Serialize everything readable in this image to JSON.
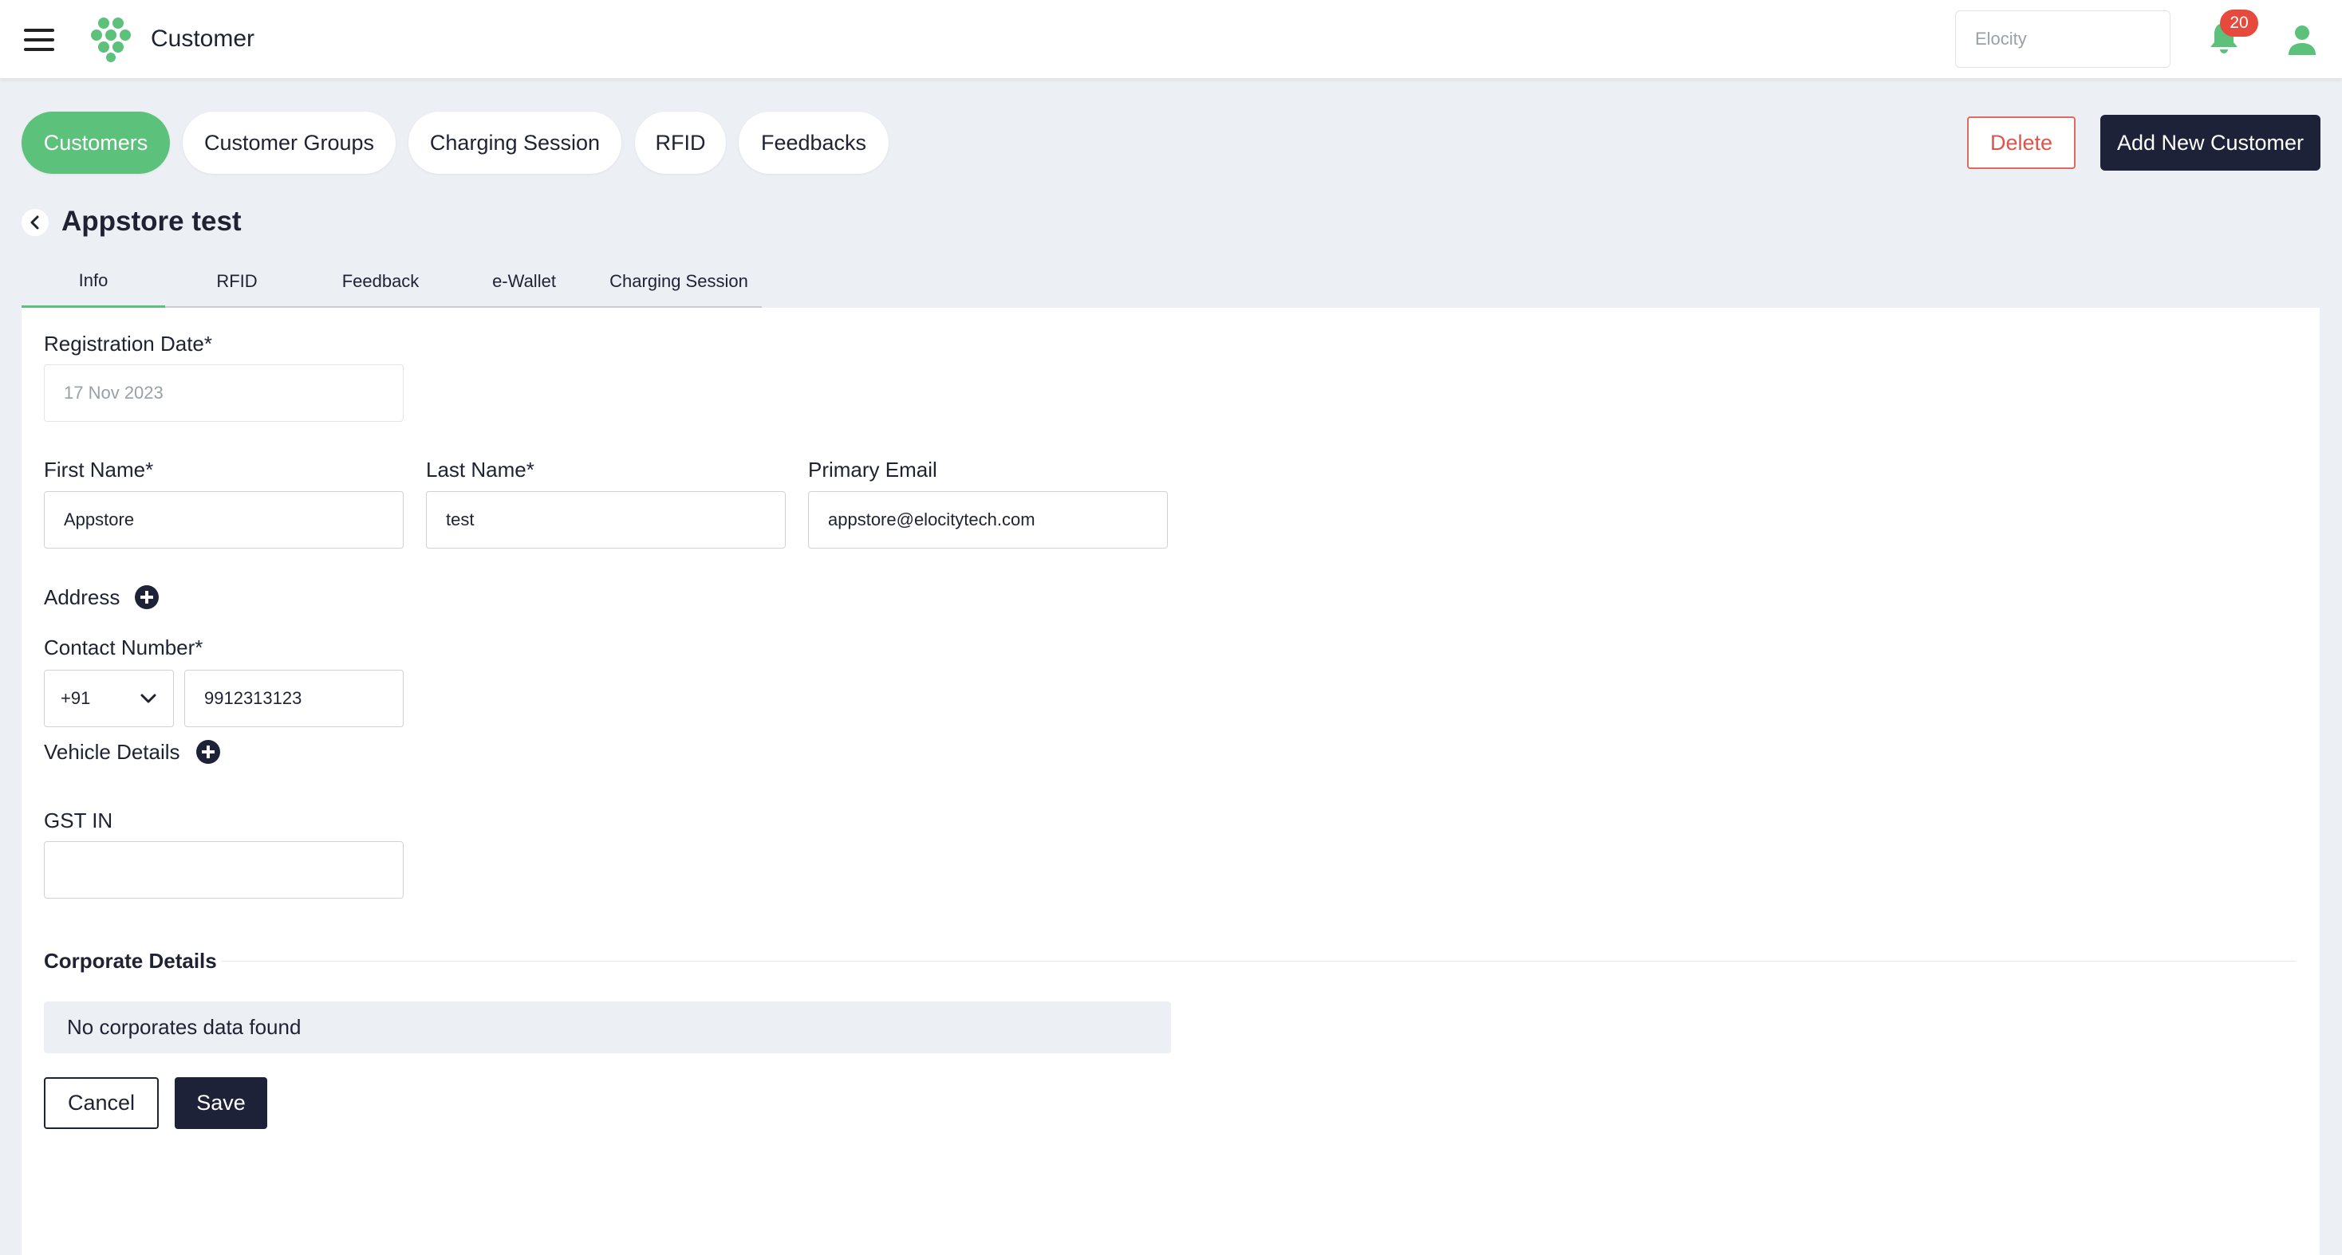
{
  "header": {
    "title": "Customer",
    "org_select_placeholder": "Elocity",
    "notification_count": "20",
    "brand_color": "#5cc17a"
  },
  "nav_pills": [
    {
      "label": "Customers",
      "active": true
    },
    {
      "label": "Customer Groups",
      "active": false
    },
    {
      "label": "Charging Session",
      "active": false
    },
    {
      "label": "RFID",
      "active": false
    },
    {
      "label": "Feedbacks",
      "active": false
    }
  ],
  "actions": {
    "delete_label": "Delete",
    "add_label": "Add New Customer"
  },
  "page": {
    "title": "Appstore test"
  },
  "tabs": [
    {
      "label": "Info",
      "active": true
    },
    {
      "label": "RFID",
      "active": false
    },
    {
      "label": "Feedback",
      "active": false
    },
    {
      "label": "e-Wallet",
      "active": false
    },
    {
      "label": "Charging Session",
      "active": false
    }
  ],
  "form": {
    "registration_date_label": "Registration Date*",
    "registration_date_value": "17 Nov 2023",
    "first_name_label": "First Name*",
    "first_name_value": "Appstore",
    "last_name_label": "Last Name*",
    "last_name_value": "test",
    "primary_email_label": "Primary Email",
    "primary_email_value": "appstore@elocitytech.com",
    "address_label": "Address",
    "contact_number_label": "Contact Number*",
    "country_code": "+91",
    "contact_number_value": "9912313123",
    "vehicle_details_label": "Vehicle Details",
    "gst_label": "GST IN",
    "gst_value": ""
  },
  "corporate": {
    "section_title": "Corporate Details",
    "empty_message": "No corporates data found"
  },
  "footer_buttons": {
    "cancel_label": "Cancel",
    "save_label": "Save"
  },
  "icons": {
    "menu": "hamburger-menu-icon",
    "logo": "hexagon-cluster-logo",
    "notifications": "bell-icon",
    "user": "user-icon",
    "back": "chevron-left-icon",
    "dropdown": "chevron-down-icon",
    "add": "plus-circle-icon"
  }
}
